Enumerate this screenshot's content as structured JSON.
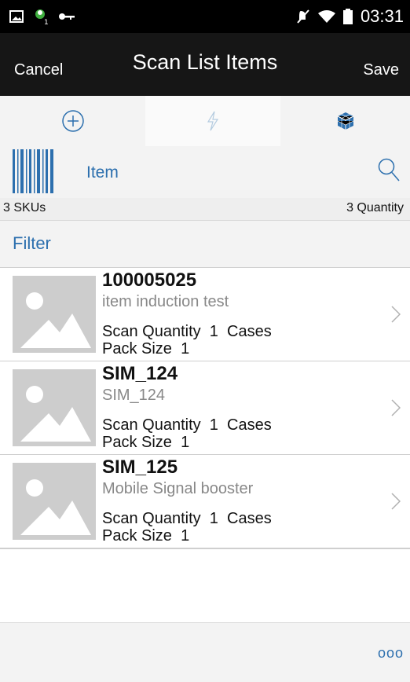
{
  "status_bar": {
    "time": "03:31"
  },
  "header": {
    "cancel_label": "Cancel",
    "title": "Scan List Items",
    "save_label": "Save"
  },
  "tabs": [
    {
      "icon": "add-circle-icon"
    },
    {
      "icon": "lightning-icon"
    },
    {
      "icon": "cube-icon"
    }
  ],
  "scan": {
    "icon": "barcode-icon",
    "label": "Item",
    "search_icon": "search-icon"
  },
  "summary": {
    "skus": "3 SKUs",
    "quantity": "3 Quantity"
  },
  "filter": {
    "label": "Filter"
  },
  "items": [
    {
      "id": "100005025",
      "description": "item induction test",
      "scan_quantity_label": "Scan Quantity",
      "scan_quantity": "1",
      "uom": "Cases",
      "pack_size_label": "Pack Size",
      "pack_size": "1"
    },
    {
      "id": "SIM_124",
      "description": "SIM_124",
      "scan_quantity_label": "Scan Quantity",
      "scan_quantity": "1",
      "uom": "Cases",
      "pack_size_label": "Pack Size",
      "pack_size": "1"
    },
    {
      "id": "SIM_125",
      "description": "Mobile Signal booster",
      "scan_quantity_label": "Scan Quantity",
      "scan_quantity": "1",
      "uom": "Cases",
      "pack_size_label": "Pack Size",
      "pack_size": "1"
    }
  ],
  "footer": {
    "more_label": "ooo"
  },
  "colors": {
    "accent": "#2c6fae",
    "header_bg": "#161616",
    "status_bg": "#000000",
    "thumb_bg": "#cdcdcd"
  }
}
